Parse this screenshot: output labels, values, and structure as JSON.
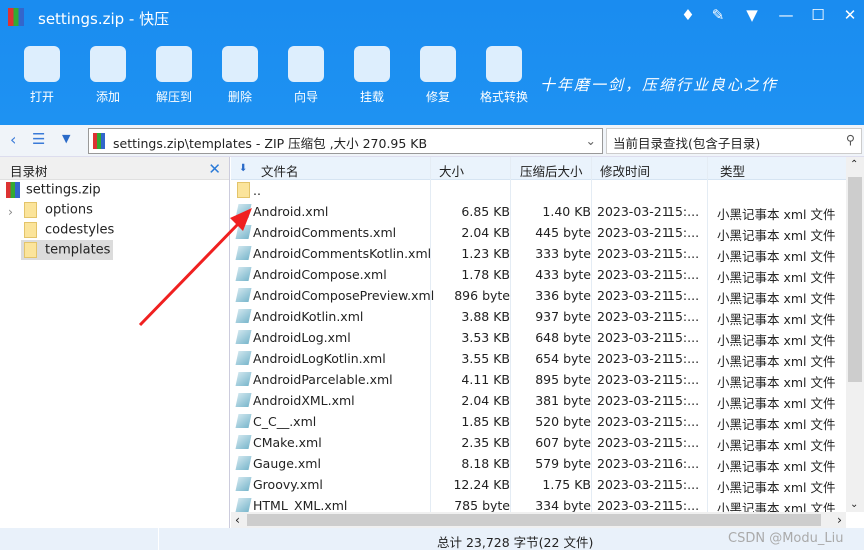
{
  "window": {
    "title": "settings.zip - 快压"
  },
  "toolbar": [
    {
      "label": "打开",
      "icon": "folder-open-icon"
    },
    {
      "label": "添加",
      "icon": "add-archive-icon"
    },
    {
      "label": "解压到",
      "icon": "extract-icon"
    },
    {
      "label": "删除",
      "icon": "trash-icon"
    },
    {
      "label": "向导",
      "icon": "compass-icon"
    },
    {
      "label": "挂载",
      "icon": "drive-icon"
    },
    {
      "label": "修复",
      "icon": "toolbox-icon"
    },
    {
      "label": "格式转换",
      "icon": "convert-icon"
    }
  ],
  "slogan": "十年磨一剑，压缩行业良心之作",
  "address": "settings.zip\\templates - ZIP 压缩包 ,大小 270.95 KB",
  "search_placeholder": "当前目录查找(包含子目录)",
  "tree": {
    "title": "目录树",
    "root": "settings.zip",
    "items": [
      "options",
      "codestyles",
      "templates"
    ],
    "selected": "templates"
  },
  "columns": [
    "文件名",
    "大小",
    "压缩后大小",
    "修改时间",
    "类型"
  ],
  "parent": "..",
  "files": [
    [
      "Android.xml",
      "6.85 KB",
      "1.40 KB",
      "2023-03-21",
      "15:...",
      "小黑记事本 xml 文件"
    ],
    [
      "AndroidComments.xml",
      "2.04 KB",
      "445 byte",
      "2023-03-21",
      "15:...",
      "小黑记事本 xml 文件"
    ],
    [
      "AndroidCommentsKotlin.xml",
      "1.23 KB",
      "333 byte",
      "2023-03-21",
      "15:...",
      "小黑记事本 xml 文件"
    ],
    [
      "AndroidCompose.xml",
      "1.78 KB",
      "433 byte",
      "2023-03-21",
      "15:...",
      "小黑记事本 xml 文件"
    ],
    [
      "AndroidComposePreview.xml",
      "896 byte",
      "336 byte",
      "2023-03-21",
      "15:...",
      "小黑记事本 xml 文件"
    ],
    [
      "AndroidKotlin.xml",
      "3.88 KB",
      "937 byte",
      "2023-03-21",
      "15:...",
      "小黑记事本 xml 文件"
    ],
    [
      "AndroidLog.xml",
      "3.53 KB",
      "648 byte",
      "2023-03-21",
      "15:...",
      "小黑记事本 xml 文件"
    ],
    [
      "AndroidLogKotlin.xml",
      "3.55 KB",
      "654 byte",
      "2023-03-21",
      "15:...",
      "小黑记事本 xml 文件"
    ],
    [
      "AndroidParcelable.xml",
      "4.11 KB",
      "895 byte",
      "2023-03-21",
      "15:...",
      "小黑记事本 xml 文件"
    ],
    [
      "AndroidXML.xml",
      "2.04 KB",
      "381 byte",
      "2023-03-21",
      "15:...",
      "小黑记事本 xml 文件"
    ],
    [
      "C_C__.xml",
      "1.85 KB",
      "520 byte",
      "2023-03-21",
      "15:...",
      "小黑记事本 xml 文件"
    ],
    [
      "CMake.xml",
      "2.35 KB",
      "607 byte",
      "2023-03-21",
      "15:...",
      "小黑记事本 xml 文件"
    ],
    [
      "Gauge.xml",
      "8.18 KB",
      "579 byte",
      "2023-03-21",
      "16:...",
      "小黑记事本 xml 文件"
    ],
    [
      "Groovy.xml",
      "12.24 KB",
      "1.75 KB",
      "2023-03-21",
      "15:...",
      "小黑记事本 xml 文件"
    ],
    [
      "HTML_XML.xml",
      "785 byte",
      "334 byte",
      "2023-03-21",
      "15:...",
      "小黑记事本 xml 文件"
    ]
  ],
  "status": "总计  23,728 字节(22 文件)",
  "watermark": "CSDN @Modu_Liu",
  "colors": {
    "brand": "#1a8cf0",
    "annotation_arrow": "#f02020"
  }
}
